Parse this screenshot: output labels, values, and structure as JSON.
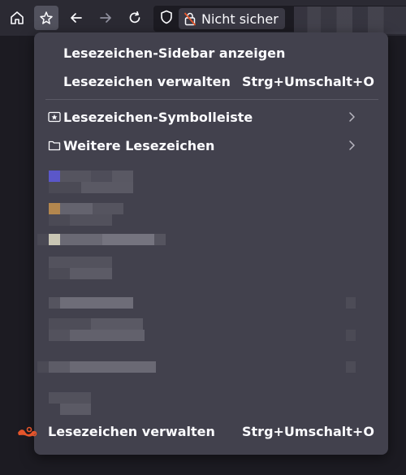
{
  "toolbar": {
    "home_icon": "home-icon",
    "bookmarks_icon": "bookmark-star-icon",
    "back_icon": "arrow-left-icon",
    "forward_icon": "arrow-right-icon",
    "reload_icon": "reload-icon",
    "shield_icon": "shield-icon",
    "security_label": "Nicht sicher",
    "security_lock_icon": "lock-insecure-icon"
  },
  "menu": {
    "show_sidebar_label": "Lesezeichen-Sidebar anzeigen",
    "manage_label": "Lesezeichen verwalten",
    "manage_shortcut": "Strg+Umschalt+O",
    "folders": [
      {
        "label": "Lesezeichen-Symbolleiste",
        "icon": "star-folder-icon"
      },
      {
        "label": "Weitere Lesezeichen",
        "icon": "folder-icon"
      }
    ]
  },
  "footer": {
    "manage_label": "Lesezeichen verwalten",
    "manage_shortcut": "Strg+Umschalt+O",
    "icon": "bookmarks-logo-icon"
  },
  "colors": {
    "menu_bg": "#42414d",
    "toolbar_bg": "#2b2a33",
    "text": "#fbfbfe",
    "accent_red": "#e5552b"
  }
}
